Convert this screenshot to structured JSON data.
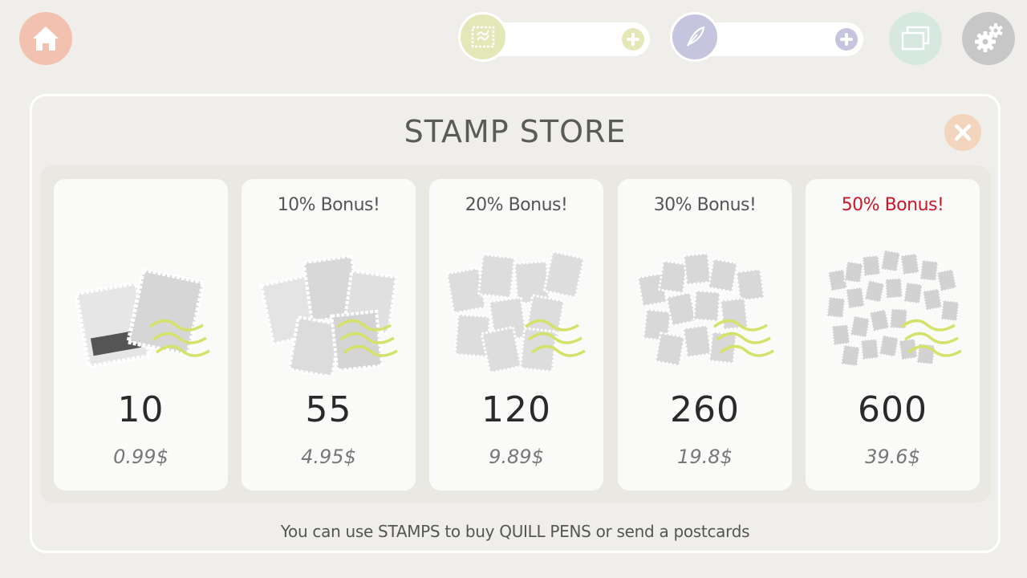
{
  "topbar": {
    "home_icon": "home-icon",
    "stamp_counter": {
      "icon": "stamp-icon",
      "value": "",
      "plus_icon": "plus-icon"
    },
    "quill_counter": {
      "icon": "quill-icon",
      "value": "",
      "plus_icon": "plus-icon"
    },
    "postcards_icon": "postcards-icon",
    "settings_icon": "gears-icon"
  },
  "store": {
    "title": "STAMP STORE",
    "close_icon": "close-icon",
    "packs": [
      {
        "bonus": "",
        "amount": "10",
        "price": "0.99$"
      },
      {
        "bonus": "10% Bonus!",
        "amount": "55",
        "price": "4.95$"
      },
      {
        "bonus": "20% Bonus!",
        "amount": "120",
        "price": "9.89$"
      },
      {
        "bonus": "30% Bonus!",
        "amount": "260",
        "price": "19.8$"
      },
      {
        "bonus": "50% Bonus!",
        "amount": "600",
        "price": "39.6$"
      }
    ],
    "footer_note": "You can use STAMPS to buy QUILL PENS or send a postcards"
  },
  "colors": {
    "background": "#efeeea",
    "home": "#f3c1b0",
    "stamp": "#e4e8b8",
    "quill": "#c5c5e0",
    "postcards": "#d7e8e0",
    "settings": "#c7c7c7",
    "close": "#f2d5bc",
    "bonus_highlight": "#c8182a",
    "stamp_accent": "#d5e26a"
  }
}
